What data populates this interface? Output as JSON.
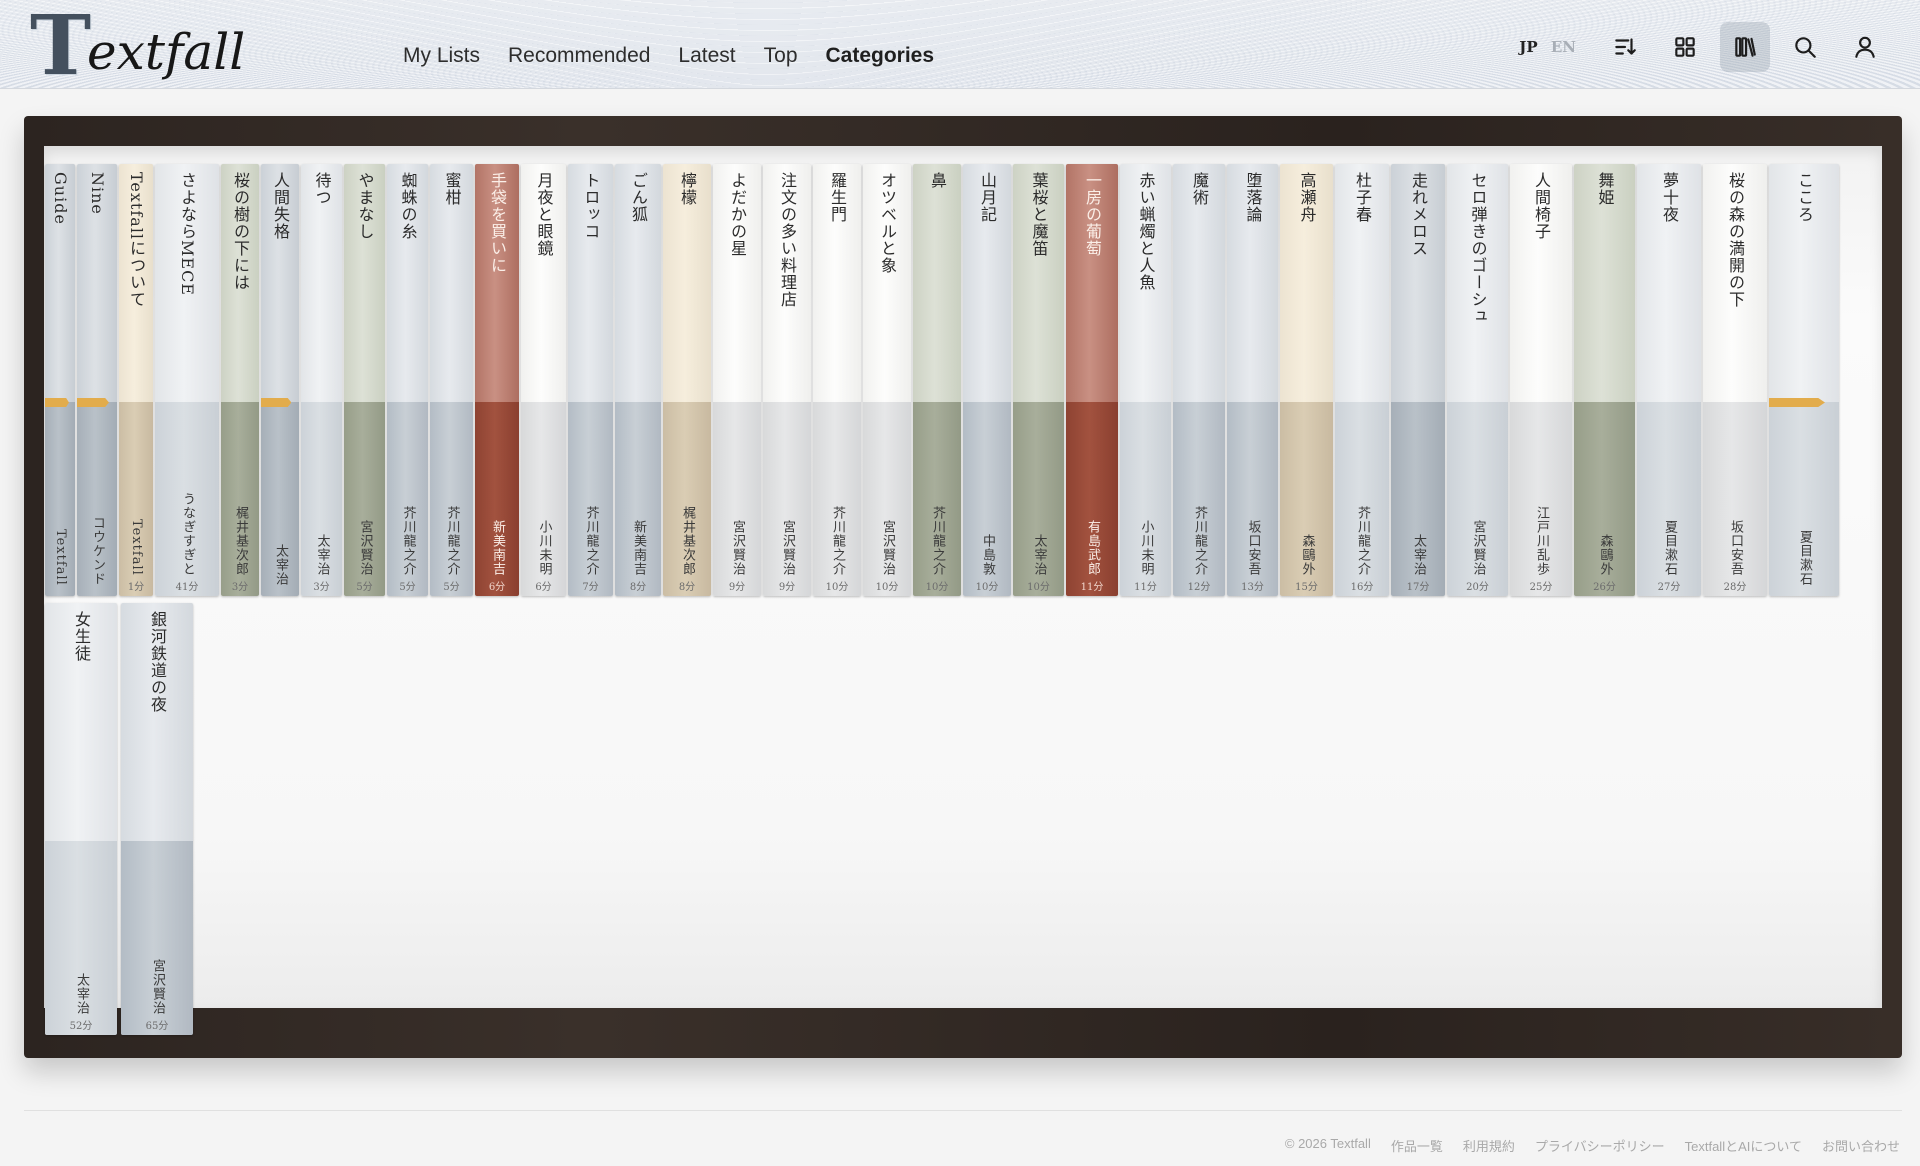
{
  "header": {
    "logo_first": "T",
    "logo_rest": "extfall",
    "nav": [
      "My Lists",
      "Recommended",
      "Latest",
      "Top",
      "Categories"
    ],
    "active_nav": "Categories",
    "lang_jp": "JP",
    "lang_en": "EN",
    "tools": [
      "sort-icon",
      "grid-icon",
      "bookshelf-icon",
      "search-icon",
      "user-icon"
    ],
    "active_tool": "bookshelf-icon"
  },
  "books_row1": [
    {
      "title": "Guide",
      "author": "Textfall",
      "mins": "",
      "color": "slate",
      "ribbon": true
    },
    {
      "title": "Nine",
      "author": "コウケンド",
      "mins": "",
      "color": "slate",
      "ribbon": true
    },
    {
      "title": "Textfallについて",
      "author": "Textfall",
      "mins": "1分",
      "color": "cream",
      "ribbon": false
    },
    {
      "title": "さよならMECE",
      "author": "うなぎすぎと",
      "mins": "41分",
      "color": "lgray",
      "ribbon": false
    },
    {
      "title": "桜の樹の下には",
      "author": "梶井基次郎",
      "mins": "3分",
      "color": "sage",
      "ribbon": false
    },
    {
      "title": "人間失格",
      "author": "太宰治",
      "mins": "",
      "color": "slate",
      "ribbon": true
    },
    {
      "title": "待つ",
      "author": "太宰治",
      "mins": "3分",
      "color": "lgray",
      "ribbon": false
    },
    {
      "title": "やまなし",
      "author": "宮沢賢治",
      "mins": "5分",
      "color": "sage",
      "ribbon": false
    },
    {
      "title": "蜘蛛の糸",
      "author": "芥川龍之介",
      "mins": "5分",
      "color": "gray",
      "ribbon": false
    },
    {
      "title": "蜜柑",
      "author": "芥川龍之介",
      "mins": "5分",
      "color": "gray",
      "ribbon": false
    },
    {
      "title": "手袋を買いに",
      "author": "新美南吉",
      "mins": "6分",
      "color": "red",
      "ribbon": false
    },
    {
      "title": "月夜と眼鏡",
      "author": "小川未明",
      "mins": "6分",
      "color": "white",
      "ribbon": false
    },
    {
      "title": "トロッコ",
      "author": "芥川龍之介",
      "mins": "7分",
      "color": "gray",
      "ribbon": false
    },
    {
      "title": "ごん狐",
      "author": "新美南吉",
      "mins": "8分",
      "color": "gray",
      "ribbon": false
    },
    {
      "title": "檸檬",
      "author": "梶井基次郎",
      "mins": "8分",
      "color": "cream",
      "ribbon": false
    },
    {
      "title": "よだかの星",
      "author": "宮沢賢治",
      "mins": "9分",
      "color": "white",
      "ribbon": false
    },
    {
      "title": "注文の多い料理店",
      "author": "宮沢賢治",
      "mins": "9分",
      "color": "white",
      "ribbon": false
    },
    {
      "title": "羅生門",
      "author": "芥川龍之介",
      "mins": "10分",
      "color": "white",
      "ribbon": false
    },
    {
      "title": "オツベルと象",
      "author": "宮沢賢治",
      "mins": "10分",
      "color": "white",
      "ribbon": false
    },
    {
      "title": "鼻",
      "author": "芥川龍之介",
      "mins": "10分",
      "color": "sage",
      "ribbon": false
    },
    {
      "title": "山月記",
      "author": "中島敦",
      "mins": "10分",
      "color": "gray",
      "ribbon": false
    },
    {
      "title": "葉桜と魔笛",
      "author": "太宰治",
      "mins": "10分",
      "color": "sage",
      "ribbon": false
    },
    {
      "title": "一房の葡萄",
      "author": "有島武郎",
      "mins": "11分",
      "color": "red",
      "ribbon": false
    },
    {
      "title": "赤い蝋燭と人魚",
      "author": "小川未明",
      "mins": "11分",
      "color": "lgray",
      "ribbon": false
    },
    {
      "title": "魔術",
      "author": "芥川龍之介",
      "mins": "12分",
      "color": "gray",
      "ribbon": false
    },
    {
      "title": "堕落論",
      "author": "坂口安吾",
      "mins": "13分",
      "color": "gray",
      "ribbon": false
    },
    {
      "title": "高瀬舟",
      "author": "森鷗外",
      "mins": "15分",
      "color": "cream",
      "ribbon": false
    },
    {
      "title": "杜子春",
      "author": "芥川龍之介",
      "mins": "16分",
      "color": "lgray",
      "ribbon": false
    },
    {
      "title": "走れメロス",
      "author": "太宰治",
      "mins": "17分",
      "color": "slate",
      "ribbon": false
    },
    {
      "title": "セロ弾きのゴーシュ",
      "author": "宮沢賢治",
      "mins": "20分",
      "color": "lgray",
      "ribbon": false
    },
    {
      "title": "人間椅子",
      "author": "江戸川乱歩",
      "mins": "25分",
      "color": "white",
      "ribbon": false
    },
    {
      "title": "舞姫",
      "author": "森鷗外",
      "mins": "26分",
      "color": "sage",
      "ribbon": false
    },
    {
      "title": "夢十夜",
      "author": "夏目漱石",
      "mins": "27分",
      "color": "lgray",
      "ribbon": false
    },
    {
      "title": "桜の森の満開の下",
      "author": "坂口安吾",
      "mins": "28分",
      "color": "white",
      "ribbon": false
    },
    {
      "title": "こころ",
      "author": "夏目漱石",
      "mins": "",
      "color": "lgray",
      "ribbon": true
    }
  ],
  "books_row2": [
    {
      "title": "女生徒",
      "author": "太宰治",
      "mins": "52分",
      "color": "lgray",
      "ribbon": false
    },
    {
      "title": "銀河鉄道の夜",
      "author": "宮沢賢治",
      "mins": "65分",
      "color": "gray",
      "ribbon": false
    }
  ],
  "footer": {
    "copyright": "© 2026 Textfall",
    "links": [
      "作品一覧",
      "利用規約",
      "プライバシーポリシー",
      "TextfallとAIについて",
      "お問い合わせ"
    ]
  }
}
